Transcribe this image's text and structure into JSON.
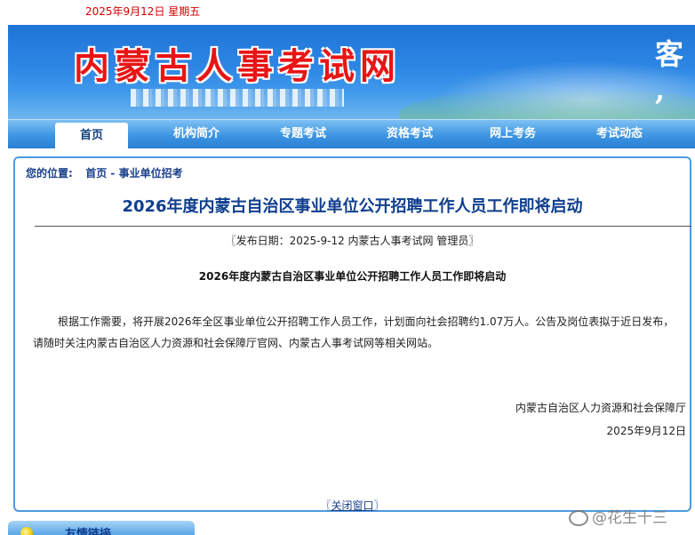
{
  "top": {
    "date": "2025年9月12日 星期五"
  },
  "banner": {
    "site_title": "内蒙古人事考试网",
    "right_text": "客 ,"
  },
  "nav": {
    "items": [
      "首页",
      "机构简介",
      "专题考试",
      "资格考试",
      "网上考务",
      "考试动态"
    ],
    "active": "首页"
  },
  "breadcrumb": {
    "label": "您的位置:",
    "home": "首页",
    "sep": " - ",
    "current": "事业单位招考"
  },
  "article": {
    "title": "2026年度内蒙古自治区事业单位公开招聘工作人员工作即将启动",
    "meta": "〖发布日期：2025-9-12 内蒙古人事考试网 管理员〗",
    "subhead": "2026年度内蒙古自治区事业单位公开招聘工作人员工作即将启动",
    "body": "根据工作需要，将开展2026年全区事业单位公开招聘工作人员工作，计划面向社会招聘约1.07万人。公告及岗位表拟于近日发布，请随时关注内蒙古自治区人力资源和社会保障厅官网、内蒙古人事考试网等相关网站。",
    "signature": "内蒙古自治区人力资源和社会保障厅",
    "sign_date": "2025年9月12日",
    "close_prefix": "〖",
    "close_label": "关闭窗口",
    "close_suffix": "〗"
  },
  "bottom": {
    "label": "友情链接"
  },
  "watermark": {
    "text": "@花生十三"
  }
}
